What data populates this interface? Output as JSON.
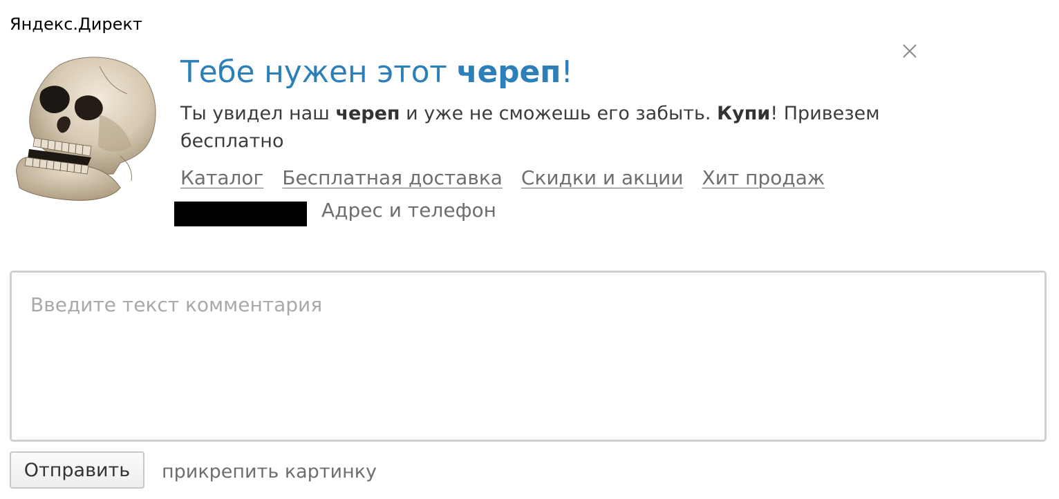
{
  "brand": "Яндекс.Директ",
  "ad": {
    "image_icon": "skull-image",
    "title_part1": "Тебе нужен этот ",
    "title_bold": "череп",
    "title_part2": "!",
    "text_part1": "Ты увидел наш ",
    "text_bold1": "череп",
    "text_part2": " и уже не сможешь его забыть. ",
    "text_bold2": "Купи",
    "text_part3": "! Привезем бесплатно",
    "links": [
      "Каталог",
      "Бесплатная доставка",
      "Скидки и акции",
      "Хит продаж"
    ],
    "address_link": "Адрес и телефон",
    "close_icon": "close-icon"
  },
  "comment": {
    "placeholder": "Введите текст комментария",
    "value": ""
  },
  "actions": {
    "submit_label": "Отправить",
    "attach_label": "прикрепить картинку"
  },
  "colors": {
    "title": "#2d7fb9",
    "text": "#3c3c3c",
    "link": "#6e6e6e",
    "border": "#cfcfcf"
  }
}
